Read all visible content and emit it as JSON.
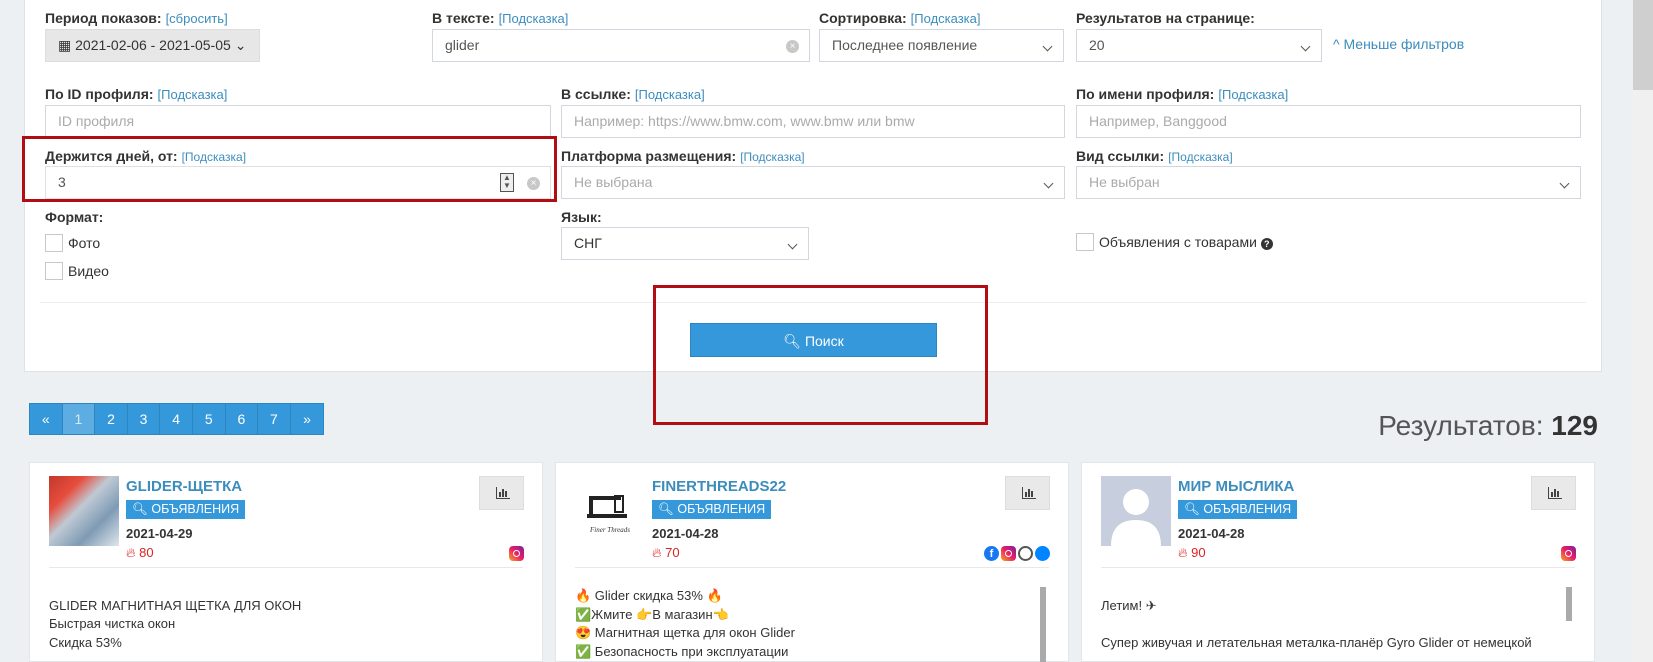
{
  "filters": {
    "period": {
      "label": "Период показов:",
      "hint": "[сбросить]",
      "value": "2021-02-06 - 2021-05-05"
    },
    "text": {
      "label": "В тексте:",
      "hint": "[Подсказка]",
      "value": "glider"
    },
    "sort": {
      "label": "Сортировка:",
      "hint": "[Подсказка]",
      "value": "Последнее появление"
    },
    "per_page": {
      "label": "Результатов на странице:",
      "value": "20"
    },
    "less_filters": "Меньше фильтров",
    "profile_id": {
      "label": "По ID профиля:",
      "hint": "[Подсказка]",
      "placeholder": "ID профиля"
    },
    "link": {
      "label": "В ссылке:",
      "hint": "[Подсказка]",
      "placeholder": "Например: https://www.bmw.com, www.bmw или bmw"
    },
    "profile_name": {
      "label": "По имени профиля:",
      "hint": "[Подсказка]",
      "placeholder": "Например, Banggood"
    },
    "days": {
      "label": "Держится дней, от:",
      "hint": "[Подсказка]",
      "value": "3"
    },
    "platform": {
      "label": "Платформа размещения:",
      "hint": "[Подсказка]",
      "value": "Не выбрана"
    },
    "link_type": {
      "label": "Вид ссылки:",
      "hint": "[Подсказка]",
      "value": "Не выбран"
    },
    "format": {
      "label": "Формат:",
      "options": [
        "Фото",
        "Видео"
      ]
    },
    "language": {
      "label": "Язык:",
      "value": "СНГ"
    },
    "with_products": "Объявления с товарами"
  },
  "search_button": "Поиск",
  "pagination": [
    "«",
    "1",
    "2",
    "3",
    "4",
    "5",
    "6",
    "7",
    "»"
  ],
  "results": {
    "label": "Результатов:",
    "count": "129"
  },
  "cards": [
    {
      "name": "GLIDER-ЩЕТКА",
      "badge": "ОБЪЯВЛЕНИЯ",
      "date": "2021-04-29",
      "fire": "80",
      "lines": [
        "",
        "GLIDER МАГНИТНАЯ ЩЕТКА ДЛЯ ОКОН",
        "Быстрая чистка окон",
        "Скидка 53%"
      ]
    },
    {
      "name": "FINERTHREADS22",
      "badge": "ОБЪЯВЛЕНИЯ",
      "date": "2021-04-28",
      "fire": "70",
      "lines": [
        "🔥 Glider скидка 53% 🔥",
        "✅Жмите 👉В магазин👈",
        "😍 Магнитная щетка для окон Glider",
        "✅ Безопасность при эксплуатации"
      ]
    },
    {
      "name": "МИР МЫСЛИКА",
      "badge": "ОБЪЯВЛЕНИЯ",
      "date": "2021-04-28",
      "fire": "90",
      "lines": [
        "",
        "Летим! ✈",
        "",
        "Супер живучая и летательная металка-планёр Gyro Glider от немецкой"
      ]
    }
  ]
}
